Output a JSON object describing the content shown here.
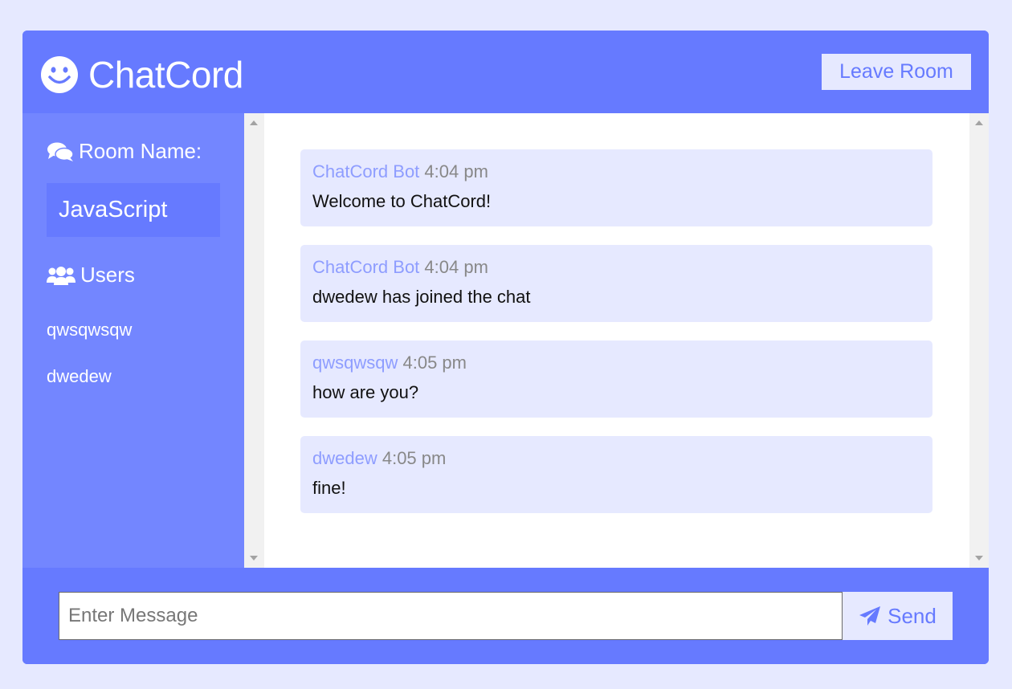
{
  "header": {
    "logo_text": "ChatCord",
    "leave_label": "Leave Room"
  },
  "sidebar": {
    "room_heading": "Room Name:",
    "room_name": "JavaScript",
    "users_heading": "Users",
    "users": [
      "qwsqwsqw",
      "dwedew"
    ]
  },
  "messages": [
    {
      "author": "ChatCord Bot",
      "time": "4:04 pm",
      "text": "Welcome to ChatCord!"
    },
    {
      "author": "ChatCord Bot",
      "time": "4:04 pm",
      "text": "dwedew has joined the chat"
    },
    {
      "author": "qwsqwsqw",
      "time": "4:05 pm",
      "text": "how are you?"
    },
    {
      "author": "dwedew",
      "time": "4:05 pm",
      "text": "fine!"
    }
  ],
  "footer": {
    "input_placeholder": "Enter Message",
    "input_value": "",
    "send_label": "Send"
  },
  "icons": {
    "logo": "smile-icon",
    "room": "comments-icon",
    "users": "users-icon",
    "send": "paper-plane-icon"
  },
  "colors": {
    "primary": "#667aff",
    "sidebar": "#7386ff",
    "light": "#e6e9ff",
    "author": "#8e9dff"
  }
}
